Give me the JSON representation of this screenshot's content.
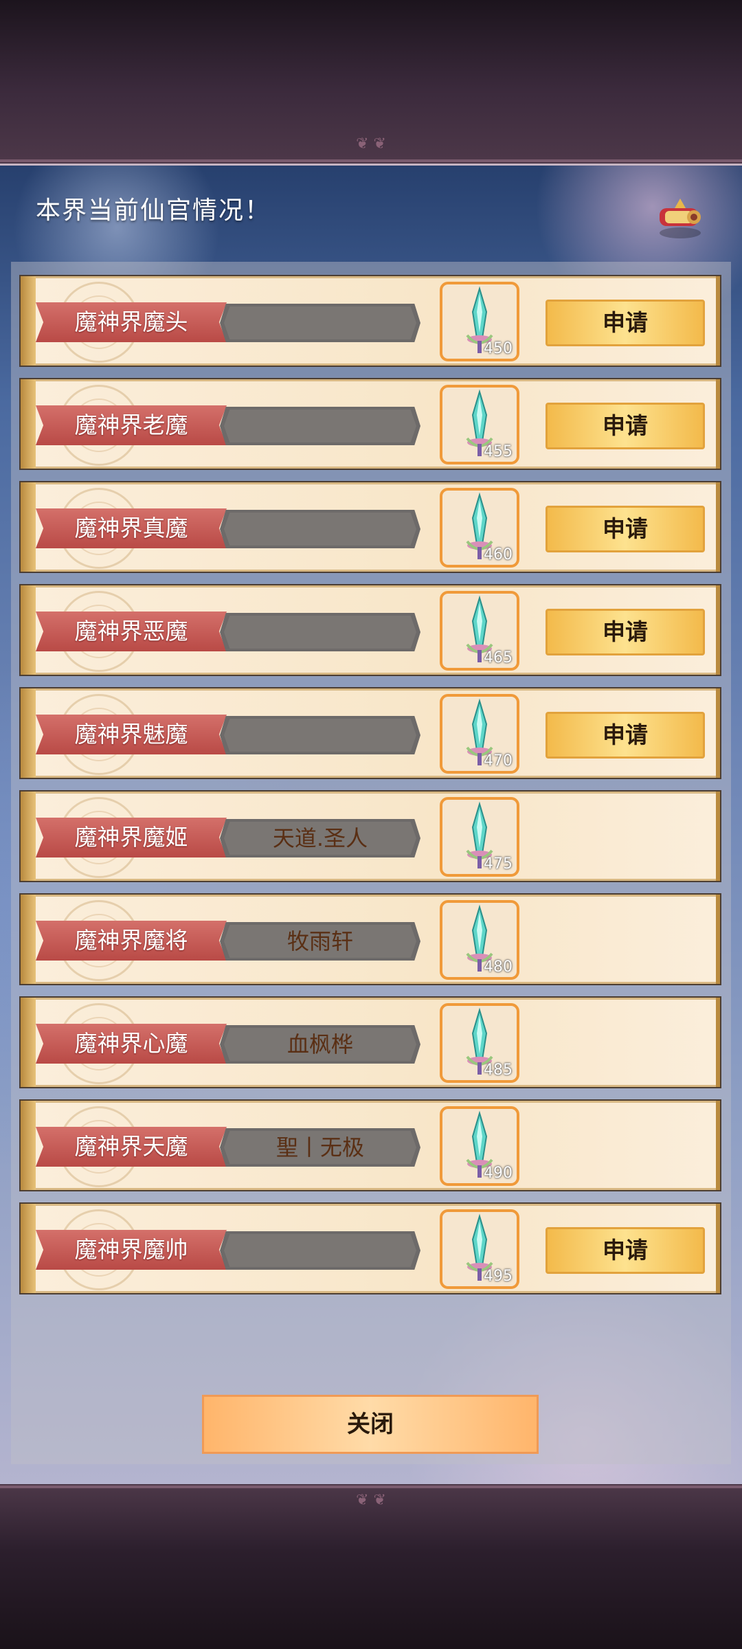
{
  "header": {
    "title": "本界当前仙官情况！"
  },
  "rows": [
    {
      "title": "魔神界魔头",
      "holder": "",
      "reward": "450",
      "button": "申请"
    },
    {
      "title": "魔神界老魔",
      "holder": "",
      "reward": "455",
      "button": "申请"
    },
    {
      "title": "魔神界真魔",
      "holder": "",
      "reward": "460",
      "button": "申请"
    },
    {
      "title": "魔神界恶魔",
      "holder": "",
      "reward": "465",
      "button": "申请"
    },
    {
      "title": "魔神界魅魔",
      "holder": "",
      "reward": "470",
      "button": "申请"
    },
    {
      "title": "魔神界魔姬",
      "holder": "天道.圣人",
      "reward": "475",
      "button": ""
    },
    {
      "title": "魔神界魔将",
      "holder": "牧雨轩",
      "reward": "480",
      "button": ""
    },
    {
      "title": "魔神界心魔",
      "holder": "血枫桦",
      "reward": "485",
      "button": ""
    },
    {
      "title": "魔神界天魔",
      "holder": "聖丨无极",
      "reward": "490",
      "button": ""
    },
    {
      "title": "魔神界魔帅",
      "holder": "",
      "reward": "495",
      "button": "申请"
    }
  ],
  "footer": {
    "close_label": "关闭"
  },
  "icons": {
    "reward": "sword-icon",
    "header": "scroll-icon"
  },
  "colors": {
    "apply_button": "#fbd46e",
    "close_button": "#ffc58a",
    "title_ribbon": "#c85a55"
  }
}
